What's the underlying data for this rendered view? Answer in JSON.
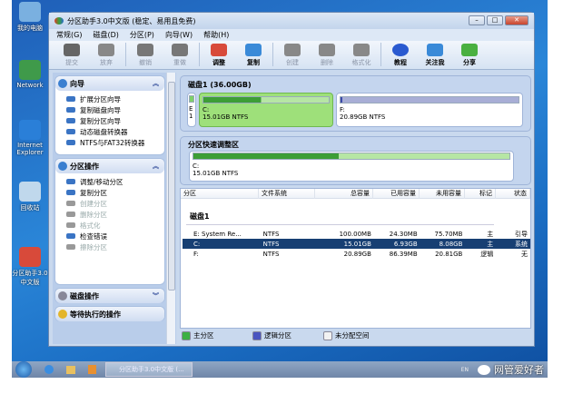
{
  "desktop": {
    "icons": [
      {
        "label": "我的电脑",
        "icon": "computer-icon"
      },
      {
        "label": "Network",
        "icon": "network-icon"
      },
      {
        "label": "Internet Explorer",
        "icon": "ie-icon"
      },
      {
        "label": "回收站",
        "icon": "recycle-bin-icon"
      },
      {
        "label": "分区助手3.0中文版",
        "icon": "partition-assistant-icon"
      }
    ]
  },
  "window": {
    "title": "分区助手3.0中文版 (稳定、易用且免费)"
  },
  "menu": [
    "常规(G)",
    "磁盘(D)",
    "分区(P)",
    "向导(W)",
    "帮助(H)"
  ],
  "toolbar": [
    {
      "label": "提交",
      "enabled": false
    },
    {
      "label": "放弃",
      "enabled": false
    },
    {
      "label": "撤销",
      "enabled": false
    },
    {
      "label": "重做",
      "enabled": false
    },
    {
      "label": "调整",
      "enabled": true
    },
    {
      "label": "复制",
      "enabled": true
    },
    {
      "label": "创建",
      "enabled": false
    },
    {
      "label": "删除",
      "enabled": false
    },
    {
      "label": "格式化",
      "enabled": false
    },
    {
      "label": "教程",
      "enabled": true
    },
    {
      "label": "关注我",
      "enabled": true
    },
    {
      "label": "分享",
      "enabled": true
    }
  ],
  "sidebar": {
    "wizard": {
      "title": "向导",
      "items": [
        "扩展分区向导",
        "复制磁盘向导",
        "复制分区向导",
        "动态磁盘转换器",
        "NTFS与FAT32转换器"
      ]
    },
    "partition_ops": {
      "title": "分区操作",
      "items": [
        {
          "label": "调整/移动分区",
          "enabled": true
        },
        {
          "label": "复制分区",
          "enabled": true
        },
        {
          "label": "创建分区",
          "enabled": false
        },
        {
          "label": "删除分区",
          "enabled": false
        },
        {
          "label": "格式化",
          "enabled": false
        },
        {
          "label": "检查错误",
          "enabled": true
        },
        {
          "label": "擦除分区",
          "enabled": false
        }
      ]
    },
    "disk_ops": {
      "title": "磁盘操作"
    },
    "pending": {
      "title": "等待执行的操作"
    }
  },
  "diskmap": {
    "title": "磁盘1 (36.00GB)",
    "parts": [
      {
        "name": "E",
        "sub": "1"
      },
      {
        "name": "C:",
        "info": "15.01GB NTFS",
        "used_pct": 46
      },
      {
        "name": "F:",
        "info": "20.89GB NTFS",
        "used_pct": 0.4
      }
    ]
  },
  "quick": {
    "title": "分区快速调整区",
    "name": "C:",
    "info": "15.01GB NTFS",
    "used_pct": 46
  },
  "table": {
    "headers": [
      "分区",
      "文件系统",
      "总容量",
      "已用容量",
      "未用容量",
      "标记",
      "状态"
    ],
    "group": "磁盘1",
    "rows": [
      [
        "E:  System Re...",
        "NTFS",
        "100.00MB",
        "24.30MB",
        "75.70MB",
        "主",
        "引导"
      ],
      [
        "C:",
        "NTFS",
        "15.01GB",
        "6.93GB",
        "8.08GB",
        "主",
        "系统"
      ],
      [
        "F:",
        "NTFS",
        "20.89GB",
        "86.39MB",
        "20.81GB",
        "逻辑",
        "无"
      ]
    ],
    "selected": 1
  },
  "legend": [
    {
      "label": "主分区",
      "color": "#3cb043"
    },
    {
      "label": "逻辑分区",
      "color": "#4a55c0"
    },
    {
      "label": "未分配空间",
      "color": "#f2f2f2"
    }
  ],
  "taskbar": {
    "task": "分区助手3.0中文版 (...",
    "lang": "EN",
    "watermark": "网管爱好者"
  }
}
